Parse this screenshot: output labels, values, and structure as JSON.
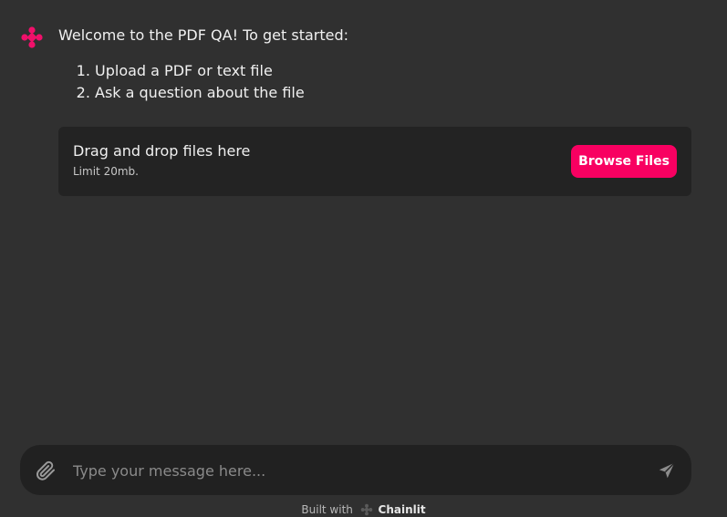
{
  "message": {
    "avatar_icon": "chainlit-logo-icon",
    "title": "Welcome to the PDF QA! To get started:",
    "steps": [
      "Upload a PDF or text file",
      "Ask a question about the file"
    ]
  },
  "upload": {
    "title": "Drag and drop files here",
    "limit": "Limit 20mb.",
    "browse_label": "Browse Files"
  },
  "composer": {
    "placeholder": "Type your message here...",
    "attach_icon": "paperclip-icon",
    "send_icon": "send-icon"
  },
  "footer": {
    "built_with": "Built with",
    "brand": "Chainlit"
  },
  "colors": {
    "background": "#303030",
    "panel": "#232323",
    "accent": "#f80061",
    "input_bg": "#212121"
  }
}
